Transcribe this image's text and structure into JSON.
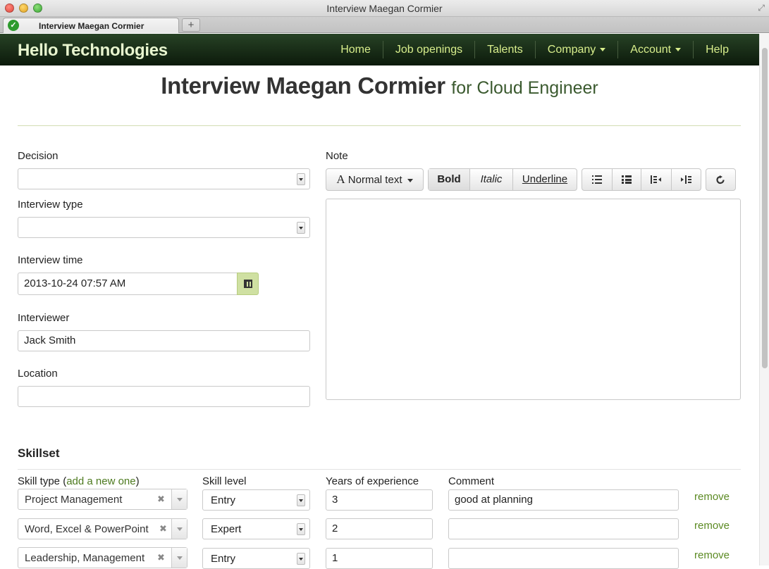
{
  "window": {
    "title": "Interview Maegan Cormier",
    "tab_label": "Interview Maegan Cormier",
    "new_tab": "+"
  },
  "nav": {
    "brand": "Hello Technologies",
    "items": [
      {
        "label": "Home",
        "dropdown": false
      },
      {
        "label": "Job openings",
        "dropdown": false
      },
      {
        "label": "Talents",
        "dropdown": false
      },
      {
        "label": "Company",
        "dropdown": true
      },
      {
        "label": "Account",
        "dropdown": true
      },
      {
        "label": "Help",
        "dropdown": false
      }
    ]
  },
  "page": {
    "title": "Interview Maegan Cormier",
    "subtitle": "for Cloud Engineer"
  },
  "form": {
    "decision": {
      "label": "Decision",
      "value": ""
    },
    "interview_type": {
      "label": "Interview type",
      "value": ""
    },
    "interview_time": {
      "label": "Interview time",
      "value": "2013-10-24 07:57 AM"
    },
    "interviewer": {
      "label": "Interviewer",
      "value": "Jack Smith"
    },
    "location": {
      "label": "Location",
      "value": ""
    },
    "note": {
      "label": "Note",
      "value": ""
    }
  },
  "toolbar": {
    "text_style": "Normal text",
    "bold": "Bold",
    "italic": "Italic",
    "underline": "Underline",
    "icons": [
      "unordered-list-icon",
      "ordered-list-icon",
      "outdent-icon",
      "indent-icon",
      "undo-icon"
    ]
  },
  "skillset": {
    "heading": "Skillset",
    "columns": {
      "skill_type": "Skill type (",
      "add_link": "add a new one",
      "skill_type_close": ")",
      "skill_level": "Skill level",
      "years": "Years of experience",
      "comment": "Comment"
    },
    "remove_label": "remove",
    "rows": [
      {
        "skill": "Project Management",
        "level": "Entry",
        "years": "3",
        "comment": "good at planning"
      },
      {
        "skill": "Word, Excel & PowerPoint",
        "level": "Expert",
        "years": "2",
        "comment": ""
      },
      {
        "skill": "Leadership, Management",
        "level": "Entry",
        "years": "1",
        "comment": ""
      }
    ]
  },
  "colors": {
    "nav_bg": "#1a2e18",
    "nav_link": "#d8ee8c",
    "accent_green": "#cfe0a2",
    "link_green": "#5b8a22"
  }
}
